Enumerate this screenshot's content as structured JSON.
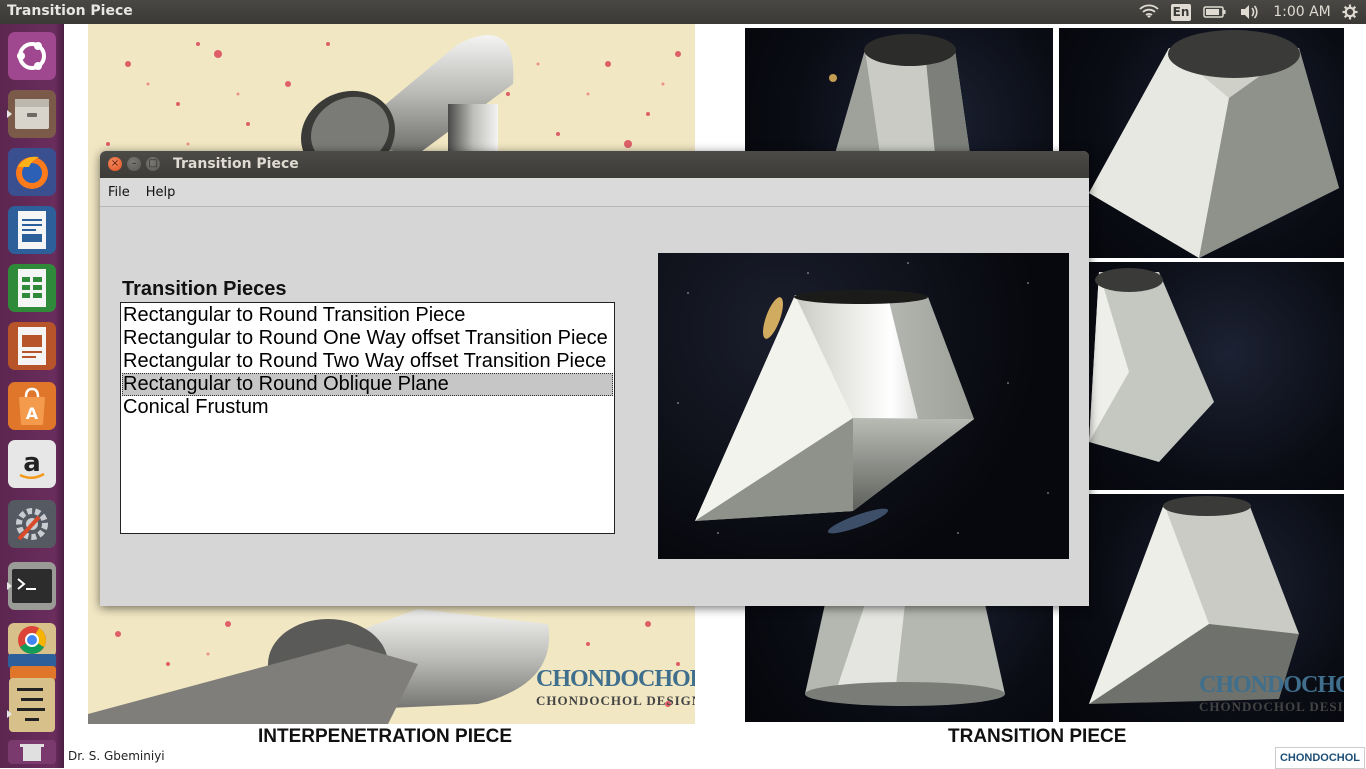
{
  "top_panel": {
    "app_title": "Transition Piece",
    "language": "En",
    "clock": "1:00 AM",
    "icons": [
      "wifi-icon",
      "keyboard-language-indicator",
      "battery-icon",
      "volume-icon",
      "settings-gear-icon"
    ]
  },
  "launcher": {
    "items": [
      "ubuntu-dash-icon",
      "files-icon",
      "firefox-icon",
      "writer-icon",
      "calc-icon",
      "impress-icon",
      "software-center-icon",
      "amazon-icon",
      "system-settings-icon",
      "terminal-icon",
      "chrome-icon",
      "app-stack-icon",
      "trash-icon"
    ]
  },
  "desktop": {
    "left_caption": "INTERPENETRATION PIECE",
    "right_caption": "TRANSITION PIECE",
    "author": "Dr. S. Gbeminiyi",
    "watermark_big": "CHONDOCHOL",
    "watermark_small": "CHONDOCHOL DESIGN",
    "corner_logo": "CHONDOCHOL"
  },
  "window": {
    "title": "Transition Piece",
    "menu": [
      "File",
      "Help"
    ],
    "section_title": "Transition Pieces",
    "items": [
      "Rectangular to Round Transition Piece",
      "Rectangular to Round One Way offset Transition Piece",
      "Rectangular to Round Two Way offset Transition Piece",
      "Rectangular to Round Oblique Plane",
      "Conical Frustum"
    ],
    "selected_item": "Rectangular to Round Oblique Plane",
    "close_glyph": "×",
    "minimize_glyph": "–",
    "maximize_glyph": "□"
  },
  "colors": {
    "accent_close": "#e0531d",
    "launcher_bg": "#5b2650",
    "panel_bg": "#3c3b37",
    "window_bg": "#d6d6d6",
    "selection": "#c6c6c6"
  }
}
